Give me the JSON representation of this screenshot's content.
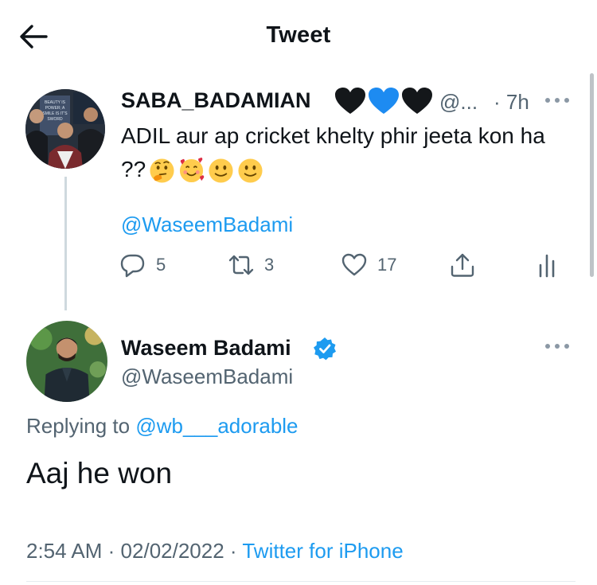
{
  "header": {
    "title": "Tweet"
  },
  "parent_tweet": {
    "display_name": "SABA_BADAMIAN",
    "name_emojis": [
      "black-heart",
      "blue-heart",
      "black-heart"
    ],
    "handle": "@...",
    "time": "· 7h",
    "text": "ADIL aur ap cricket khelty phir jeeta kon ha ??",
    "text_emojis": [
      "thinking-face",
      "smiling-face-with-hearts",
      "slightly-smiling-face",
      "slightly-smiling-face"
    ],
    "mention": "@WaseemBadami",
    "stats": {
      "replies": "5",
      "retweets": "3",
      "likes": "17"
    },
    "avatar_sign_text": [
      "BEAUTY IS",
      "POWER; A",
      "SMILE IS IT'S",
      "SWORD"
    ],
    "colors": {
      "heart_black": "#14171a",
      "heart_blue": "#1d8bf1"
    }
  },
  "main_tweet": {
    "display_name": "Waseem Badami",
    "verified": true,
    "handle": "@WaseemBadami",
    "replying_prefix": "Replying to",
    "replying_to": "@wb___adorable",
    "text": "Aaj he won",
    "time": "2:54 AM",
    "date": "02/02/2022",
    "separator": "·",
    "source": "Twitter for iPhone"
  },
  "theme": {
    "link": "#1d9bf0",
    "muted": "#536471",
    "text": "#0f1419"
  }
}
